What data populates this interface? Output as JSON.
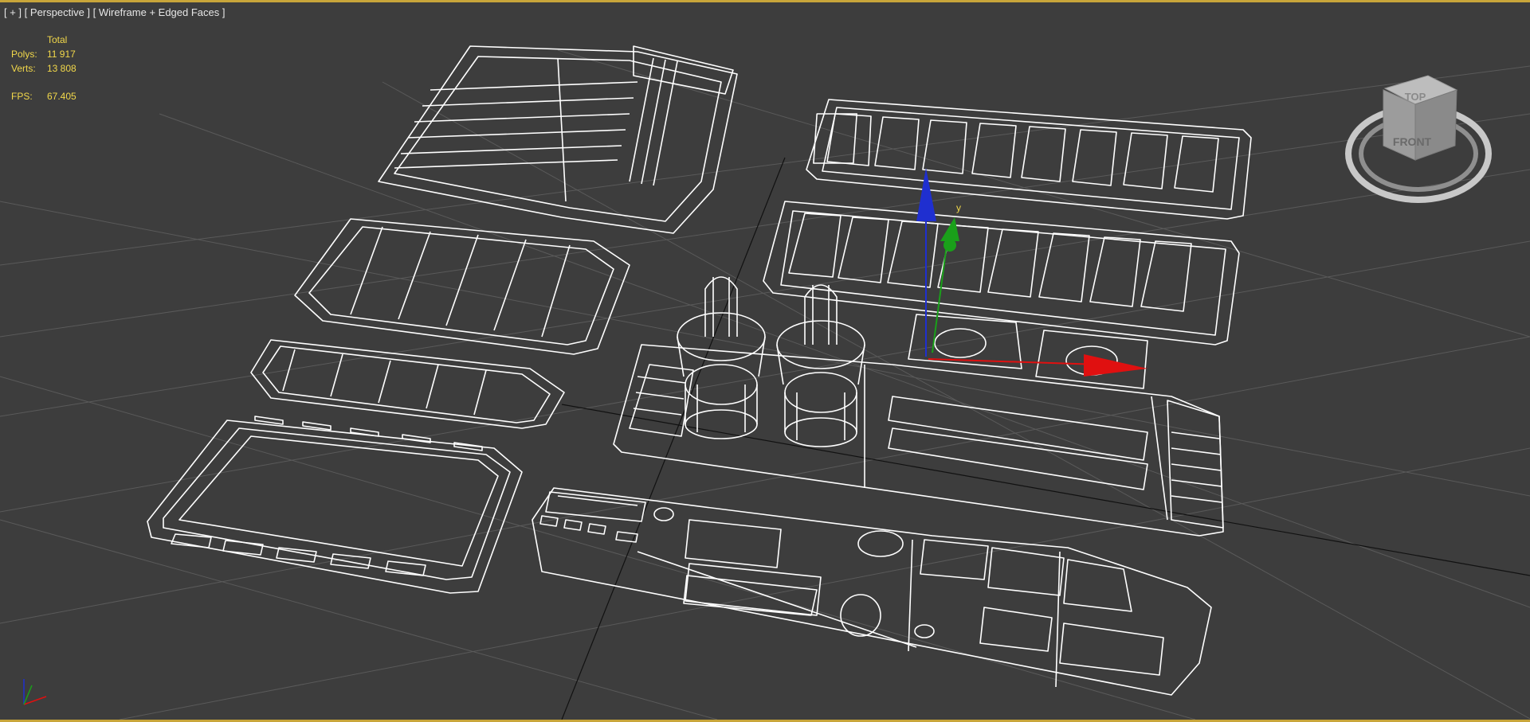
{
  "viewport": {
    "labels": {
      "plus": "[ + ]",
      "view": "[ Perspective ]",
      "shading": "[ Wireframe + Edged Faces ]"
    },
    "stats": {
      "header": "Total",
      "polys_label": "Polys:",
      "polys_value": "11 917",
      "verts_label": "Verts:",
      "verts_value": "13 808",
      "fps_label": "FPS:",
      "fps_value": "67.405"
    },
    "viewcube": {
      "top": "TOP",
      "front": "FRONT"
    },
    "gizmo": {
      "y_label": "y"
    },
    "colors": {
      "background": "#3d3d3d",
      "border": "#c8a53a",
      "stats_text": "#f2d84a",
      "wire": "#ffffff",
      "gizmo_x": "#e01010",
      "gizmo_y": "#1aa01a",
      "gizmo_z": "#1f2fd0"
    }
  }
}
